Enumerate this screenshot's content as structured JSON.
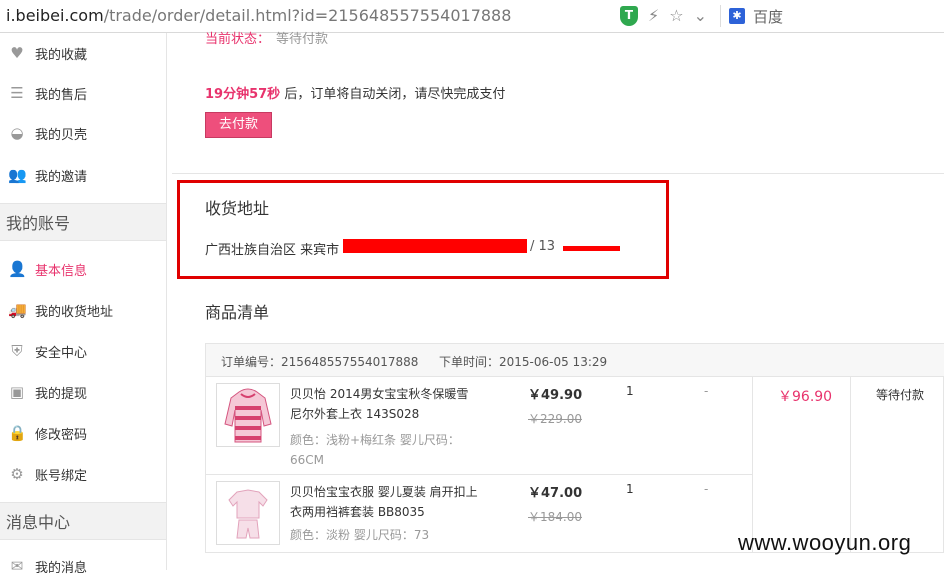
{
  "browser": {
    "url_host": "i.beibei.com",
    "url_path": "/trade/order/detail.html?id=215648557554017888",
    "shield_label": "T",
    "search_engine": "百度"
  },
  "sidebar": {
    "items_top": [
      {
        "label": "我的收藏",
        "icon": "heart-icon"
      },
      {
        "label": "我的售后",
        "icon": "sliders-icon"
      },
      {
        "label": "我的贝壳",
        "icon": "shell-icon"
      },
      {
        "label": "我的邀请",
        "icon": "invite-icon"
      }
    ],
    "section_account": "我的账号",
    "items_account": [
      {
        "label": "基本信息",
        "icon": "user-icon",
        "active": true
      },
      {
        "label": "我的收货地址",
        "icon": "truck-icon"
      },
      {
        "label": "安全中心",
        "icon": "shield-icon"
      },
      {
        "label": "我的提现",
        "icon": "wallet-icon"
      },
      {
        "label": "修改密码",
        "icon": "lock-icon"
      },
      {
        "label": "账号绑定",
        "icon": "bind-icon"
      }
    ],
    "section_messages": "消息中心",
    "items_messages": [
      {
        "label": "我的消息",
        "icon": "message-icon"
      }
    ]
  },
  "order": {
    "status_label": "当前状态：",
    "status_value": "等待付款",
    "countdown_time": "19分钟57秒",
    "countdown_text": " 后，订单将自动关闭，请尽快完成支付",
    "pay_button": "去付款",
    "address_title": "收货地址",
    "address_prefix": "广西壮族自治区 来宾市 ",
    "address_phone": "/ 13",
    "goods_title": "商品清单",
    "order_number": "订单编号：215648557554017888",
    "order_time": "下单时间：2015-06-05 13:29",
    "total": "￥96.90",
    "pay_status": "等待付款",
    "products": [
      {
        "name": "贝贝怡 2014男女宝宝秋冬保暖雪尼尔外套上衣 143S028",
        "attr": "颜色：浅粉+梅红条  婴儿尺码：66CM",
        "price": "￥49.90",
        "orig_price": "￥229.00",
        "qty": "1",
        "discount": "-"
      },
      {
        "name": "贝贝怡宝宝衣服 婴儿夏装 肩开扣上衣两用裆裤套装 BB8035",
        "attr": "颜色：淡粉  婴儿尺码：73",
        "price": "￥47.00",
        "orig_price": "￥184.00",
        "qty": "1",
        "discount": "-"
      }
    ]
  },
  "watermark": "www.wooyun.org"
}
